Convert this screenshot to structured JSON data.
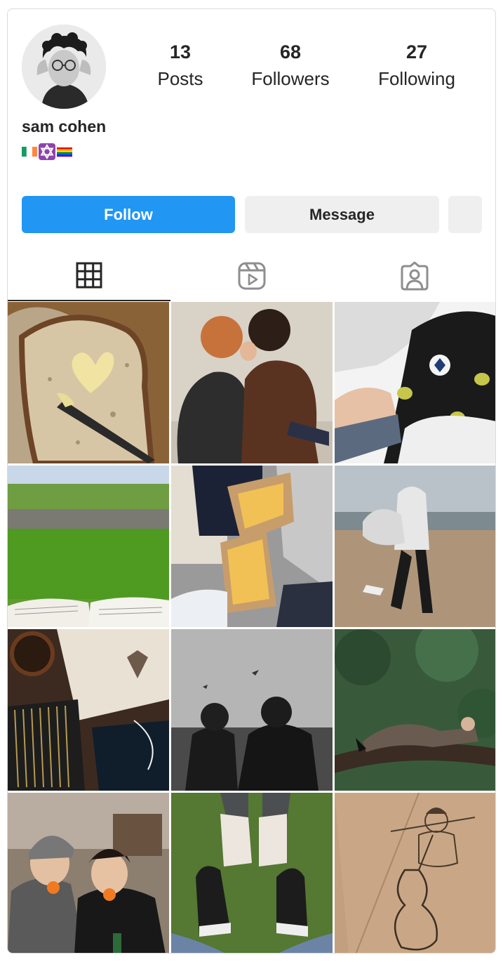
{
  "profile": {
    "username": "sam cohen",
    "bio_emojis": [
      "flag-ireland",
      "star-of-david",
      "rainbow-flag"
    ]
  },
  "stats": [
    {
      "value": "13",
      "label": "Posts"
    },
    {
      "value": "68",
      "label": "Followers"
    },
    {
      "value": "27",
      "label": "Following"
    }
  ],
  "actions": {
    "follow_label": "Follow",
    "message_label": "Message"
  },
  "tabs": [
    "grid-icon",
    "reels-icon",
    "tagged-icon"
  ],
  "colors": {
    "follow_button": "#2196f3",
    "secondary_button": "#efefef",
    "text": "#262626"
  },
  "posts": [
    {
      "subject": "bread-with-heart-butter"
    },
    {
      "subject": "couple-kissing"
    },
    {
      "subject": "converse-sneakers-alien-socks"
    },
    {
      "subject": "green-field-with-book"
    },
    {
      "subject": "fries-boxes"
    },
    {
      "subject": "piggyback-on-beach"
    },
    {
      "subject": "sketchbook-pencils-coffee"
    },
    {
      "subject": "black-and-white-couple-sea"
    },
    {
      "subject": "person-lying-on-tree"
    },
    {
      "subject": "friends-with-oranges"
    },
    {
      "subject": "sneakers-on-grass"
    },
    {
      "subject": "violinist-sketch"
    }
  ]
}
